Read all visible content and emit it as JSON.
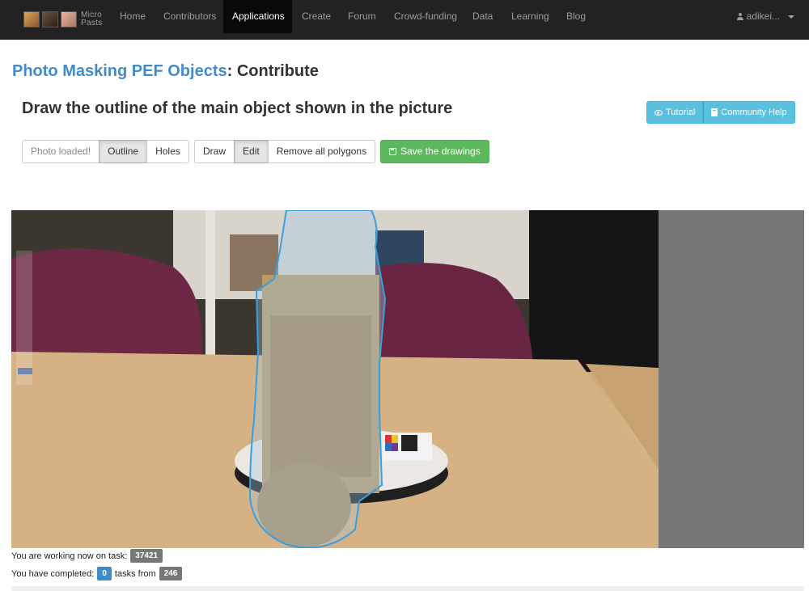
{
  "nav": {
    "brand_top": "Micro",
    "brand_bottom": "Pasts",
    "items": [
      {
        "label": "Home"
      },
      {
        "label": "Contributors"
      },
      {
        "label": "Applications"
      },
      {
        "label": "Create"
      },
      {
        "label": "Forum"
      },
      {
        "label": "Crowd-funding"
      },
      {
        "label": "Data"
      },
      {
        "label": "Learning"
      },
      {
        "label": "Blog"
      }
    ],
    "active": "Applications",
    "user": "adikei..."
  },
  "header": {
    "project": "Photo Masking PEF Objects",
    "suffix": ": Contribute",
    "instruction": "Draw the outline of the main object shown in the picture"
  },
  "help": {
    "tutorial": "Tutorial",
    "community": "Community Help"
  },
  "toolbar": {
    "status": "Photo loaded!",
    "outline": "Outline",
    "holes": "Holes",
    "draw": "Draw",
    "edit": "Edit",
    "remove": "Remove all polygons",
    "save": "Save the drawings"
  },
  "task": {
    "working_label": "You are working now on task:",
    "task_id": "37421",
    "completed_label": "You have completed:",
    "completed": "0",
    "from_label": "tasks from",
    "total": "246"
  },
  "colors": {
    "link": "#428bca",
    "info": "#5bc0de",
    "success": "#5cb85c",
    "polygon_stroke": "#3a9fdc"
  }
}
